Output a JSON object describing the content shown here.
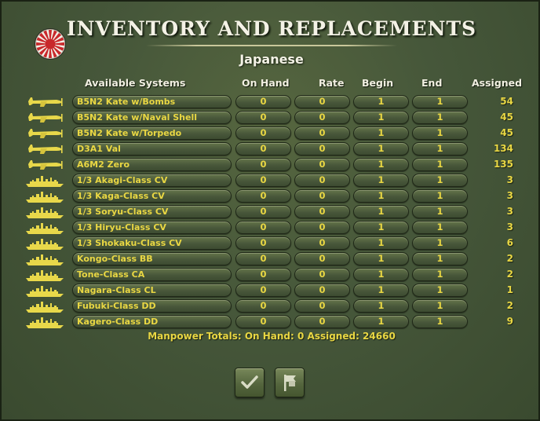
{
  "title": "INVENTORY AND REPLACEMENTS",
  "subtitle": "Japanese",
  "colors": {
    "background": "#46573a",
    "value_text": "#e9d743",
    "header_text": "#f2f0e2"
  },
  "headers": {
    "system": "Available Systems",
    "on_hand": "On Hand",
    "rate": "Rate",
    "begin": "Begin",
    "end": "End",
    "assigned": "Assigned"
  },
  "rows": [
    {
      "icon": "aircraft-icon",
      "name": "B5N2 Kate w/Bombs",
      "on_hand": "0",
      "rate": "0",
      "begin": "1",
      "end": "1",
      "assigned": "54"
    },
    {
      "icon": "aircraft-icon",
      "name": "B5N2 Kate w/Naval Shell",
      "on_hand": "0",
      "rate": "0",
      "begin": "1",
      "end": "1",
      "assigned": "45"
    },
    {
      "icon": "aircraft-icon",
      "name": "B5N2 Kate w/Torpedo",
      "on_hand": "0",
      "rate": "0",
      "begin": "1",
      "end": "1",
      "assigned": "45"
    },
    {
      "icon": "aircraft-icon",
      "name": "D3A1 Val",
      "on_hand": "0",
      "rate": "0",
      "begin": "1",
      "end": "1",
      "assigned": "134"
    },
    {
      "icon": "aircraft-icon",
      "name": "A6M2 Zero",
      "on_hand": "0",
      "rate": "0",
      "begin": "1",
      "end": "1",
      "assigned": "135"
    },
    {
      "icon": "ship-icon",
      "name": "1/3 Akagi-Class CV",
      "on_hand": "0",
      "rate": "0",
      "begin": "1",
      "end": "1",
      "assigned": "3"
    },
    {
      "icon": "ship-icon",
      "name": "1/3 Kaga-Class CV",
      "on_hand": "0",
      "rate": "0",
      "begin": "1",
      "end": "1",
      "assigned": "3"
    },
    {
      "icon": "ship-icon",
      "name": "1/3 Soryu-Class CV",
      "on_hand": "0",
      "rate": "0",
      "begin": "1",
      "end": "1",
      "assigned": "3"
    },
    {
      "icon": "ship-icon",
      "name": "1/3 Hiryu-Class CV",
      "on_hand": "0",
      "rate": "0",
      "begin": "1",
      "end": "1",
      "assigned": "3"
    },
    {
      "icon": "ship-icon",
      "name": "1/3 Shokaku-Class CV",
      "on_hand": "0",
      "rate": "0",
      "begin": "1",
      "end": "1",
      "assigned": "6"
    },
    {
      "icon": "ship-icon",
      "name": "Kongo-Class BB",
      "on_hand": "0",
      "rate": "0",
      "begin": "1",
      "end": "1",
      "assigned": "2"
    },
    {
      "icon": "ship-icon",
      "name": "Tone-Class CA",
      "on_hand": "0",
      "rate": "0",
      "begin": "1",
      "end": "1",
      "assigned": "2"
    },
    {
      "icon": "ship-icon",
      "name": "Nagara-Class CL",
      "on_hand": "0",
      "rate": "0",
      "begin": "1",
      "end": "1",
      "assigned": "1"
    },
    {
      "icon": "ship-icon",
      "name": "Fubuki-Class DD",
      "on_hand": "0",
      "rate": "0",
      "begin": "1",
      "end": "1",
      "assigned": "2"
    },
    {
      "icon": "ship-icon",
      "name": "Kagero-Class DD",
      "on_hand": "0",
      "rate": "0",
      "begin": "1",
      "end": "1",
      "assigned": "9"
    }
  ],
  "totals": "Manpower Totals: On Hand: 0 Assigned: 24660",
  "buttons": {
    "confirm": "checkmark-icon",
    "surrender": "white-flag-icon"
  }
}
